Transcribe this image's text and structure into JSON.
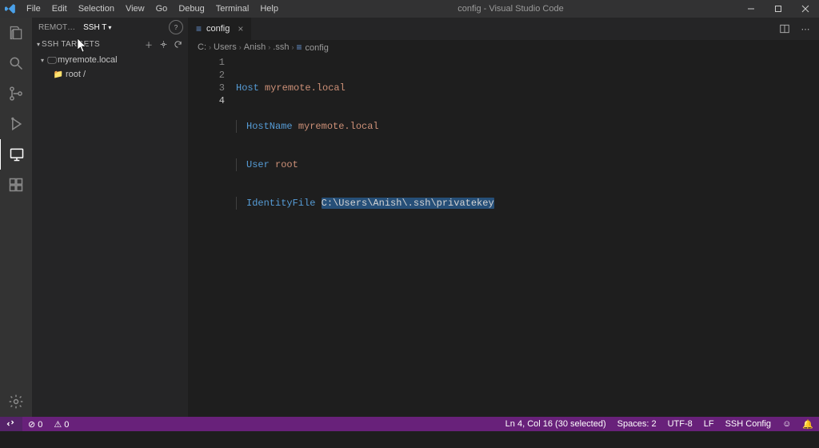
{
  "title": "config - Visual Studio Code",
  "menu": [
    "File",
    "Edit",
    "Selection",
    "View",
    "Go",
    "Debug",
    "Terminal",
    "Help"
  ],
  "activity": {
    "items": [
      "files-icon",
      "search-icon",
      "source-control-icon",
      "debug-alt-icon",
      "remote-explorer-icon",
      "extensions-icon"
    ],
    "active": 4
  },
  "sidebar": {
    "tabs": {
      "other": "REMOT…",
      "active": "SSH T"
    },
    "section": "SSH TARGETS",
    "tree": {
      "host": "myremote.local",
      "user": "root /"
    }
  },
  "editor": {
    "tab": {
      "name": "config",
      "icon": "≡"
    },
    "breadcrumb": [
      "C:",
      "Users",
      "Anish",
      ".ssh"
    ],
    "breadcrumb_file": "config",
    "code": {
      "l1": {
        "k": "Host",
        "v": "myremote.local"
      },
      "l2": {
        "k": "HostName",
        "v": "myremote.local"
      },
      "l3": {
        "k": "User",
        "v": "root"
      },
      "l4": {
        "k": "IdentityFile",
        "sel": "C:\\Users\\Anish\\.ssh\\privatekey"
      }
    }
  },
  "status": {
    "remote": "⎇",
    "errors": "⊘ 0",
    "warnings": "⚠ 0",
    "pos": "Ln 4, Col 16 (30 selected)",
    "spaces": "Spaces: 2",
    "enc": "UTF-8",
    "eol": "LF",
    "lang": "SSH Config",
    "feedback": "☺",
    "bell": "🔔"
  }
}
